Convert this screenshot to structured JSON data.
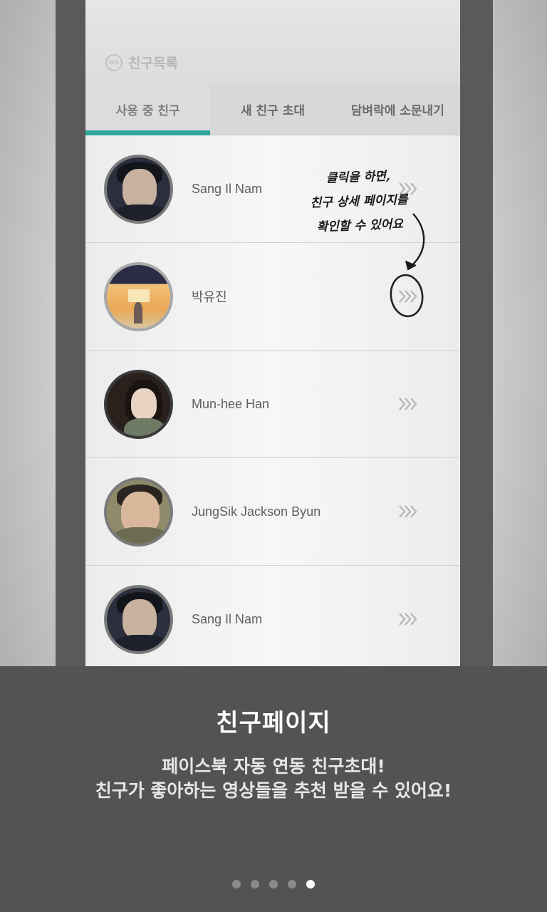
{
  "app": {
    "title": "친구목록",
    "logo_text": "ILS"
  },
  "tabs": [
    {
      "label": "사용 중 친구",
      "active": true
    },
    {
      "label": "새 친구 초대",
      "active": false
    },
    {
      "label": "담벼락에 소문내기",
      "active": false
    }
  ],
  "friends": [
    {
      "name": "Sang Il Nam",
      "avatar": "boy-icon"
    },
    {
      "name": "박유진",
      "avatar": "girl-with-sign-icon"
    },
    {
      "name": "Mun-hee Han",
      "avatar": "girl-icon"
    },
    {
      "name": "JungSik Jackson Byun",
      "avatar": "boy-icon"
    },
    {
      "name": "Sang Il Nam",
      "avatar": "boy-icon"
    }
  ],
  "annotation": {
    "line1": "클릭을 하면,",
    "line2": "친구 상세 페이지를",
    "line3": "확인할 수 있어요"
  },
  "panel": {
    "title": "친구페이지",
    "desc_line1": "페이스북 자동 연동 친구초대!",
    "desc_line2": "친구가 좋아하는 영상들을 추천 받을 수 있어요!"
  },
  "pager": {
    "count": 5,
    "current": 5
  },
  "colors": {
    "accent": "#2fa79c",
    "panel": "#535353"
  }
}
